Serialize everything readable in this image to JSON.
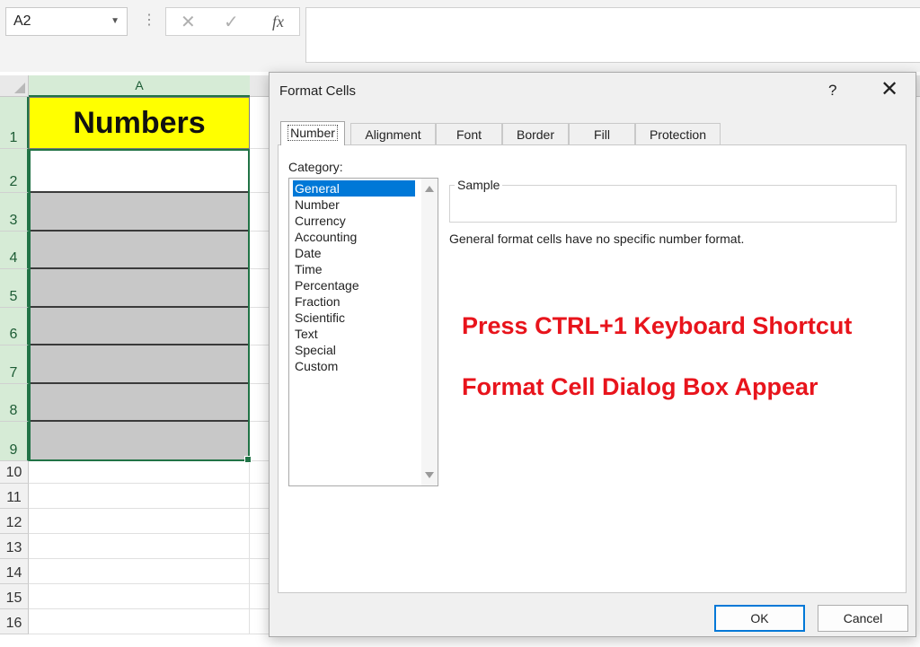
{
  "formula_bar": {
    "name_box": "A2",
    "cancel_icon": "✕",
    "enter_icon": "✓",
    "fx_label": "fx"
  },
  "sheet": {
    "column_a": "A",
    "header_cell": "Numbers",
    "rows": [
      "1",
      "2",
      "3",
      "4",
      "5",
      "6",
      "7",
      "8",
      "9",
      "10",
      "11",
      "12",
      "13",
      "14",
      "15",
      "16"
    ]
  },
  "dialog": {
    "title": "Format Cells",
    "help": "?",
    "close": "✕",
    "tabs": [
      "Number",
      "Alignment",
      "Font",
      "Border",
      "Fill",
      "Protection"
    ],
    "active_tab": "Number",
    "category_label": "Category:",
    "categories": [
      "General",
      "Number",
      "Currency",
      "Accounting",
      "Date",
      "Time",
      "Percentage",
      "Fraction",
      "Scientific",
      "Text",
      "Special",
      "Custom"
    ],
    "selected_category": "General",
    "sample_label": "Sample",
    "description": "General format cells have no specific number format.",
    "ok": "OK",
    "cancel": "Cancel"
  },
  "annotations": {
    "line1": "Press CTRL+1 Keyboard Shortcut",
    "line2": "Format Cell Dialog Box Appear",
    "color": "#e8141c"
  },
  "colors": {
    "excel_green": "#217346",
    "header_fill": "#ffff00",
    "selected_range_fill": "#c8c8c8",
    "list_selection": "#0078d7"
  }
}
